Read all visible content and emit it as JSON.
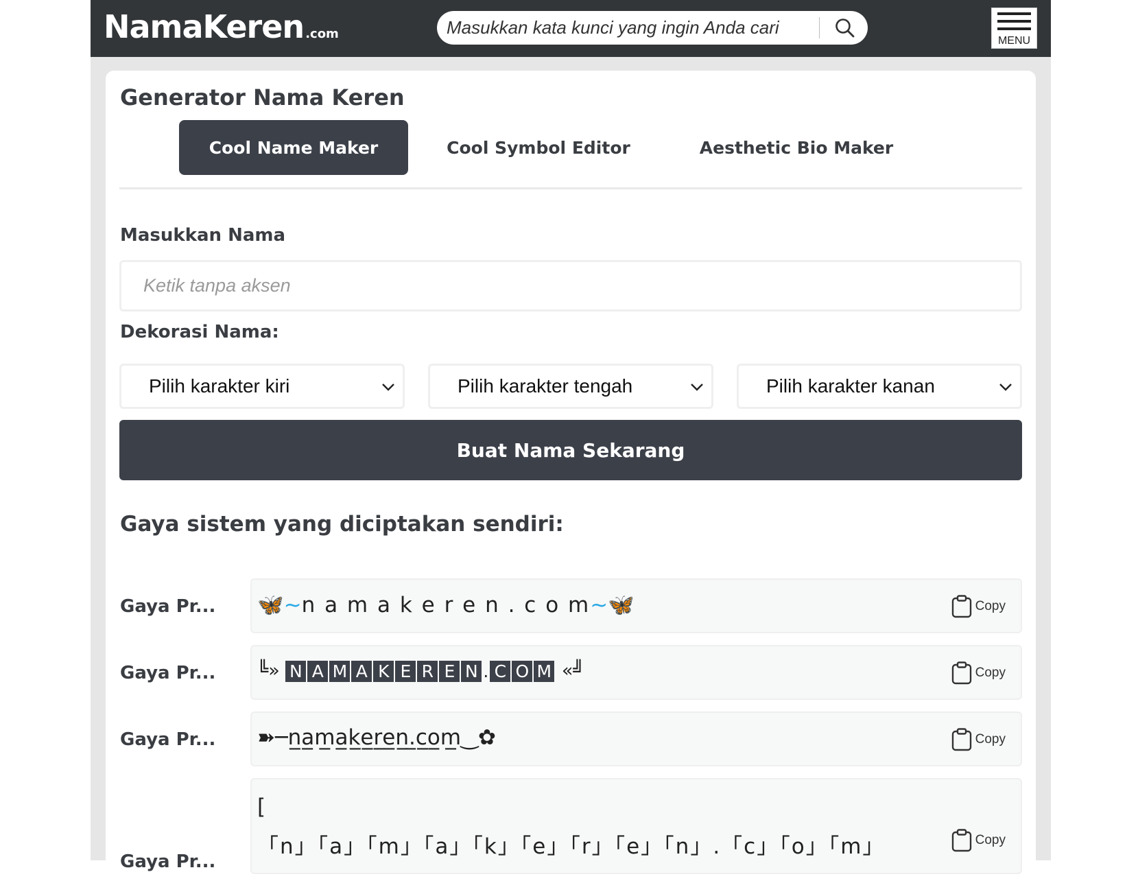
{
  "header": {
    "logo_main": "NamaKeren",
    "logo_tld": ".com",
    "search_placeholder": "Masukkan kata kunci yang ingin Anda cari",
    "menu_label": "MENU"
  },
  "card": {
    "title": "Generator Nama Keren",
    "tabs": [
      {
        "label": "Cool Name Maker",
        "active": true
      },
      {
        "label": "Cool Symbol Editor",
        "active": false
      },
      {
        "label": "Aesthetic Bio Maker",
        "active": false
      }
    ],
    "name_label": "Masukkan Nama",
    "name_placeholder": "Ketik tanpa aksen",
    "decor_label": "Dekorasi Nama:",
    "selects": [
      {
        "label": "Pilih karakter kiri"
      },
      {
        "label": "Pilih karakter tengah"
      },
      {
        "label": "Pilih karakter kanan"
      }
    ],
    "create_button": "Buat Nama Sekarang",
    "section_title": "Gaya sistem yang diciptakan sendiri:"
  },
  "results": [
    {
      "label": "Gaya Pr...",
      "prefix": "🦋~",
      "text": "n a m a k e r e n . c o m",
      "suffix": "~🦋",
      "copy": "Copy"
    },
    {
      "label": "Gaya Pr...",
      "prefix": "╚» ",
      "boxed_chars": [
        "N",
        "A",
        "M",
        "A",
        "K",
        "E",
        "R",
        "E",
        "N",
        ".",
        "C",
        "O",
        "M"
      ],
      "suffix": " «╝",
      "copy": "Copy"
    },
    {
      "label": "Gaya Pr...",
      "prefix": "➽─",
      "text": "n̲a̲m̲a̲k̲e̲r̲e̲n̲.̲c̲o̲m̲",
      "suffix": "‿✿",
      "copy": "Copy"
    },
    {
      "label": "Gaya Pr...",
      "line1": "[",
      "text": "「n」「a」「m」「a」「k」「e」「r」「e」「n」.「c」「o」「m」",
      "copy": "Copy"
    }
  ],
  "colors": {
    "header_bg": "#323639",
    "accent_dark": "#3c4049",
    "page_bg": "#e6e6e6",
    "result_bg": "#f7f8f8",
    "butterfly": "#29a9e6"
  },
  "icons": [
    "search-icon",
    "hamburger-menu-icon",
    "chevron-down-icon",
    "clipboard-icon"
  ]
}
